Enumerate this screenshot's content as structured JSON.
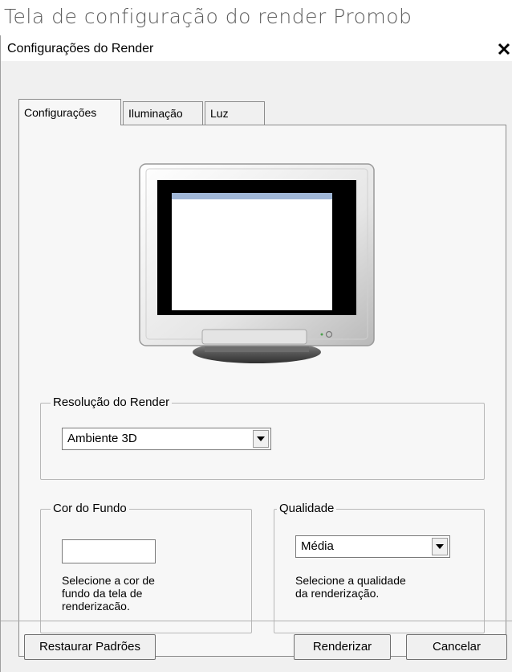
{
  "caption": "Tela de configuração do render Promob",
  "window": {
    "title": "Configurações do Render",
    "close_label": "✕"
  },
  "tabs": [
    {
      "label": "Configurações",
      "active": true
    },
    {
      "label": "Iluminação",
      "active": false
    },
    {
      "label": "Luz",
      "active": false
    }
  ],
  "resolution": {
    "legend": "Resolução do Render",
    "selected": "Ambiente 3D"
  },
  "background": {
    "legend": "Cor do Fundo",
    "help": "Selecione a cor de\nfundo da tela de\nrenderizacão."
  },
  "quality": {
    "legend": "Qualidade",
    "selected": "Média",
    "help": "Selecione a qualidade\nda renderização."
  },
  "buttons": {
    "restore": "Restaurar Padrões",
    "render": "Renderizar",
    "cancel": "Cancelar"
  },
  "icons": {
    "monitor": "crt-monitor-icon",
    "dropdown": "chevron-down-icon"
  }
}
